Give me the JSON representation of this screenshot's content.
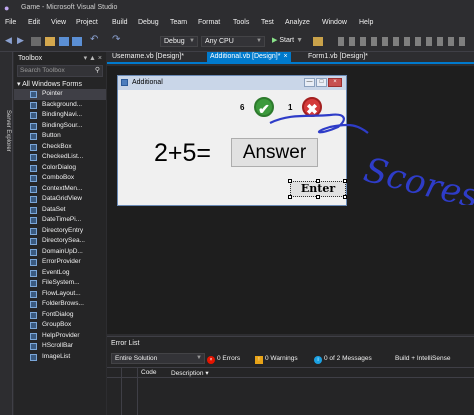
{
  "app": {
    "title": "Game - Microsoft Visual Studio"
  },
  "menu": [
    "File",
    "Edit",
    "View",
    "Project",
    "Build",
    "Debug",
    "Team",
    "Format",
    "Tools",
    "Test",
    "Analyze",
    "Window",
    "Help"
  ],
  "toolbar": {
    "config": "Debug",
    "platform": "Any CPU",
    "start": "Start"
  },
  "server_explorer": {
    "label": "Server Explorer"
  },
  "toolbox": {
    "title": "Toolbox",
    "search_placeholder": "Search Toolbox",
    "group": "All Windows Forms",
    "items": [
      "Pointer",
      "Background...",
      "BindingNavi...",
      "BindingSour...",
      "Button",
      "CheckBox",
      "CheckedList...",
      "ColorDialog",
      "ComboBox",
      "ContextMen...",
      "DataGridView",
      "DataSet",
      "DateTimePi...",
      "DirectoryEntry",
      "DirectorySea...",
      "DomainUpD...",
      "ErrorProvider",
      "EventLog",
      "FileSystem...",
      "FlowLayout...",
      "FolderBrows...",
      "FontDialog",
      "GroupBox",
      "HelpProvider",
      "HScrollBar",
      "ImageList"
    ]
  },
  "tabs": [
    {
      "label": "Username.vb [Design]*",
      "active": false
    },
    {
      "label": "Additional.vb [Design]*",
      "active": true
    },
    {
      "label": "Form1.vb [Design]*",
      "active": false
    }
  ],
  "form": {
    "caption": "Additional",
    "correct_count": "6",
    "wrong_count": "1",
    "question": "2+5=",
    "answer": "Answer",
    "enter": "Enter"
  },
  "annotation": {
    "text": "Scores",
    "color": "#2e3cc8"
  },
  "error_list": {
    "title": "Error List",
    "scope": "Entire Solution",
    "errors": "0 Errors",
    "warnings": "0 Warnings",
    "messages": "0 of 2 Messages",
    "build": "Build + IntelliSense",
    "columns": [
      "Code",
      "Description"
    ]
  },
  "colors": {
    "accent": "#007acc",
    "ok": "#3c9a3c",
    "bad": "#d43a3a"
  }
}
